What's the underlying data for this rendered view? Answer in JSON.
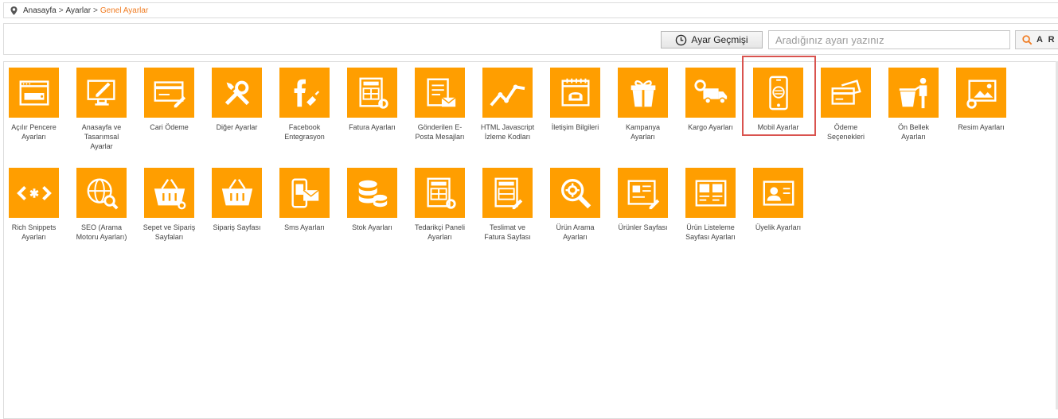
{
  "breadcrumb": {
    "items": [
      "Anasayfa",
      "Ayarlar"
    ],
    "separator": ">",
    "current": "Genel Ayarlar"
  },
  "toolbar": {
    "history_label": "Ayar Geçmişi",
    "search_placeholder": "Aradığınız ayarı yazınız",
    "search_button_label": "A R A"
  },
  "colors": {
    "tile": "#ff9e00",
    "accent": "#f07c22",
    "highlight": "#d9534f"
  },
  "highlighted_tile": "Mobil Ayarlar",
  "tiles": [
    {
      "label": "Açılır Pencere Ayarları",
      "icon": "browser-window-icon"
    },
    {
      "label": "Anasayfa ve Tasarımsal Ayarlar",
      "icon": "monitor-pen-icon"
    },
    {
      "label": "Cari Ödeme",
      "icon": "card-pen-icon"
    },
    {
      "label": "Diğer Ayarlar",
      "icon": "wrench-screwdriver-icon"
    },
    {
      "label": "Facebook Entegrasyon",
      "icon": "facebook-plug-icon"
    },
    {
      "label": "Fatura Ayarları",
      "icon": "invoice-gear-icon"
    },
    {
      "label": "Gönderilen E-Posta Mesajları",
      "icon": "document-envelope-icon"
    },
    {
      "label": "HTML Javascript İzleme Kodları",
      "icon": "line-graph-icon"
    },
    {
      "label": "İletişim Bilgileri",
      "icon": "calendar-phone-icon"
    },
    {
      "label": "Kampanya Ayarları",
      "icon": "gift-box-icon"
    },
    {
      "label": "Kargo Ayarları",
      "icon": "delivery-truck-icon"
    },
    {
      "label": "Mobil Ayarlar",
      "icon": "mobile-settings-icon"
    },
    {
      "label": "Ödeme Seçenekleri",
      "icon": "payment-cards-icon"
    },
    {
      "label": "Ön Bellek Ayarları",
      "icon": "trash-person-icon"
    },
    {
      "label": "Resim Ayarları",
      "icon": "image-gear-icon"
    },
    {
      "label": "Rich Snippets Ayarları",
      "icon": "code-tag-icon"
    },
    {
      "label": "SEO (Arama Motoru Ayarları)",
      "icon": "globe-search-icon"
    },
    {
      "label": "Sepet ve Sipariş Sayfaları",
      "icon": "basket-gear-icon"
    },
    {
      "label": "Sipariş Sayfası",
      "icon": "basket-icon"
    },
    {
      "label": "Sms Ayarları",
      "icon": "phone-message-icon"
    },
    {
      "label": "Stok Ayarları",
      "icon": "coin-stack-icon"
    },
    {
      "label": "Tedarikçi Paneli Ayarları",
      "icon": "invoice-gear-icon"
    },
    {
      "label": "Teslimat ve Fatura Sayfası",
      "icon": "invoice-pen-icon"
    },
    {
      "label": "Ürün Arama Ayarları",
      "icon": "magnifier-gear-icon"
    },
    {
      "label": "Ürünler Sayfası",
      "icon": "product-page-pen-icon"
    },
    {
      "label": "Ürün Listeleme Sayfası Ayarları",
      "icon": "product-grid-icon"
    },
    {
      "label": "Üyelik Ayarları",
      "icon": "id-card-icon"
    }
  ]
}
